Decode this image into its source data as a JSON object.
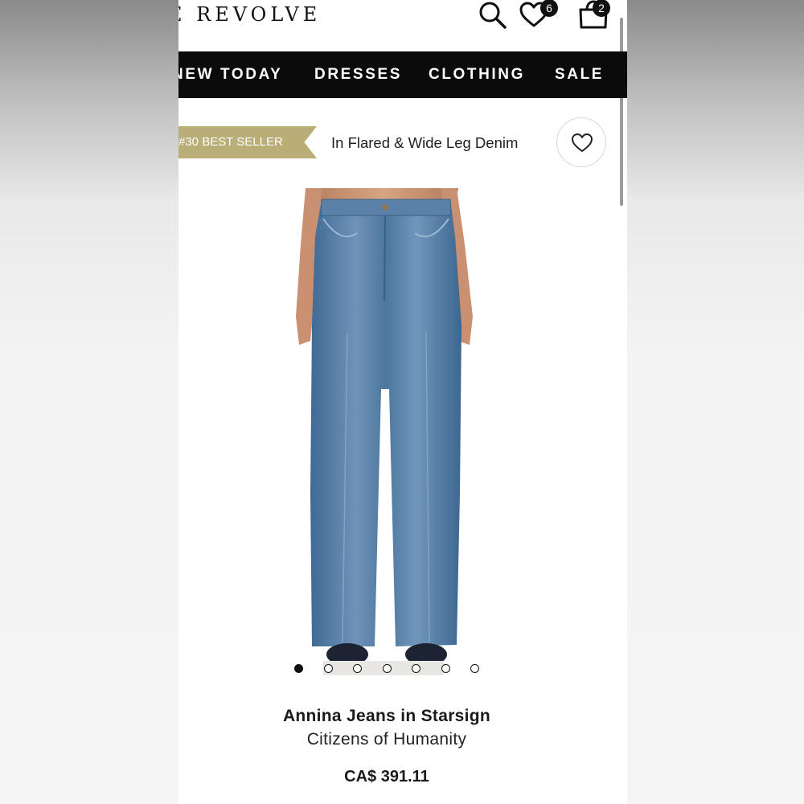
{
  "header": {
    "logo": "E REVOLVE",
    "search_icon": "search-icon",
    "wishlist_icon": "heart-icon",
    "wishlist_count": "6",
    "bag_icon": "shopping-bag-icon",
    "bag_count": "2"
  },
  "nav": {
    "items": [
      {
        "label": "NEW TODAY"
      },
      {
        "label": "DRESSES"
      },
      {
        "label": "CLOTHING"
      },
      {
        "label": "SALE"
      }
    ]
  },
  "badge": {
    "text": "#30 BEST SELLER",
    "color": "#b9ad78"
  },
  "category": {
    "label": "In Flared & Wide Leg Denim"
  },
  "favorite_icon": "heart-outline-icon",
  "carousel": {
    "total": 7,
    "active_index": 0
  },
  "product": {
    "name": "Annina Jeans in Starsign",
    "brand": "Citizens of Humanity",
    "price": "CA$ 391.11"
  },
  "colors": {
    "nav_background": "#0b0b0b",
    "denim": "#4f7aa3"
  }
}
